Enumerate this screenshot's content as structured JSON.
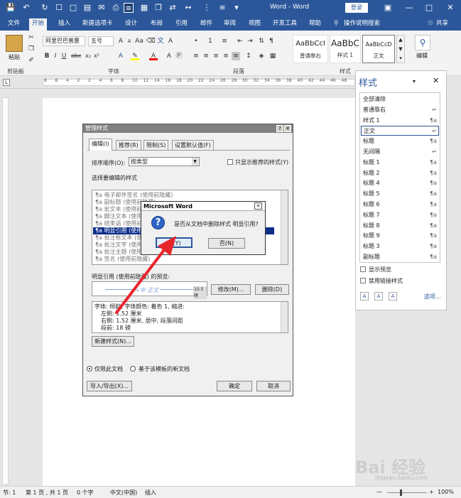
{
  "titlebar": {
    "doc_title": "Word - Word",
    "login": "登录"
  },
  "tabs": [
    "文件",
    "开始",
    "插入",
    "新建选项卡",
    "设计",
    "布局",
    "引用",
    "邮件",
    "审阅",
    "视图",
    "开发工具",
    "帮助"
  ],
  "tell_me": "操作说明搜索",
  "share": "共享",
  "ribbon": {
    "paste": "粘贴",
    "font_name": "阿里巴巴普惠",
    "font_size": "五号",
    "styles": [
      {
        "preview": "AaBbCcI",
        "name": "普通靠右"
      },
      {
        "preview": "AaBbC",
        "name": "样式 1"
      },
      {
        "preview": "AaBbCcD",
        "name": "正文"
      }
    ],
    "edit": "编辑",
    "group_labels": {
      "clipboard": "剪贴板",
      "font": "字体",
      "paragraph": "段落",
      "styles": "样式"
    }
  },
  "ruler_numbers": [
    "8",
    "6",
    "4",
    "2",
    "2",
    "4",
    "6",
    "8",
    "10",
    "12",
    "14",
    "16",
    "18",
    "20",
    "22",
    "24",
    "26",
    "28",
    "30",
    "32",
    "34",
    "36",
    "38",
    "40",
    "42",
    "44",
    "46",
    "48"
  ],
  "style_pane": {
    "title": "样式",
    "items": [
      {
        "name": "全部清除",
        "mark": ""
      },
      {
        "name": "普通靠右",
        "mark": "↵"
      },
      {
        "name": "样式 1",
        "mark": "¶a"
      },
      {
        "name": "正文",
        "mark": "↵"
      },
      {
        "name": "标题",
        "mark": "¶a"
      },
      {
        "name": "无间隔",
        "mark": "↵"
      },
      {
        "name": "标题 1",
        "mark": "¶a"
      },
      {
        "name": "标题 2",
        "mark": "¶a"
      },
      {
        "name": "标题 4",
        "mark": "¶a"
      },
      {
        "name": "标题 5",
        "mark": "¶a"
      },
      {
        "name": "标题 6",
        "mark": "¶a"
      },
      {
        "name": "标题 7",
        "mark": "¶a"
      },
      {
        "name": "标题 8",
        "mark": "¶a"
      },
      {
        "name": "标题 9",
        "mark": "¶a"
      },
      {
        "name": "标题 3",
        "mark": "¶a"
      },
      {
        "name": "副标题",
        "mark": "¶a"
      }
    ],
    "show_preview": "显示预览",
    "disable_linked": "禁用链接样式",
    "options": "选项..."
  },
  "manage_dialog": {
    "title": "管理样式",
    "tabs": [
      "编辑(I)",
      "推荐(R)",
      "限制(S)",
      "设置默认值(F)"
    ],
    "sort_label": "排序顺序(O):",
    "sort_value": "按类型",
    "only_recommended": "只显示推荐的样式(Y)",
    "select_label": "选择要编辑的样式",
    "list": [
      "电子邮件签名 (使用前隐藏)",
      "副标题 (使用前隐藏)",
      "宏文本 (使用前隐藏)",
      "脚注文本 (使用前隐藏)",
      "结束语 (使用前隐藏)",
      "明显引用 (使用前隐藏)",
      "批注框文本 (使用前隐藏)",
      "批注文字 (使用前隐藏)",
      "批注主题 (使用前隐藏)",
      "签名 (使用前隐藏)"
    ],
    "selected_index": 5,
    "preview_label": "明显引用 (使用前隐藏) 的预览:",
    "preview_text": "+中 正文",
    "preview_size": "10.5 磅",
    "modify": "修改(M)...",
    "delete": "删除(D)",
    "desc_lines": [
      "字体: 倾斜, 字体颜色: 着色 1, 缩进:",
      "左侧: 1.52 厘米",
      "右侧: 1.52 厘米, 居中, 段落间距",
      "段前: 18 磅"
    ],
    "new_style": "新建样式(N)...",
    "radio_doc": "仅限此文档",
    "radio_template": "基于该模板的新文档",
    "import_export": "导入/导出(X)...",
    "ok": "确定",
    "cancel": "取消"
  },
  "msgbox": {
    "title": "Microsoft Word",
    "message": "是否从文档中删除样式 明显引用?",
    "yes": "是(Y)",
    "no": "否(N)"
  },
  "status": {
    "section": "节: 1",
    "page": "第 1 页 , 共 1 页",
    "words": "0 个字",
    "language": "中文(中国)",
    "insert": "插入",
    "zoom": "100%"
  },
  "watermark": {
    "brand": "Bai 经验",
    "url": "jingyan.baidu.com"
  },
  "colors": {
    "accent": "#2b579a",
    "selection": "#0b2d8a",
    "arrow": "#e8242b"
  }
}
